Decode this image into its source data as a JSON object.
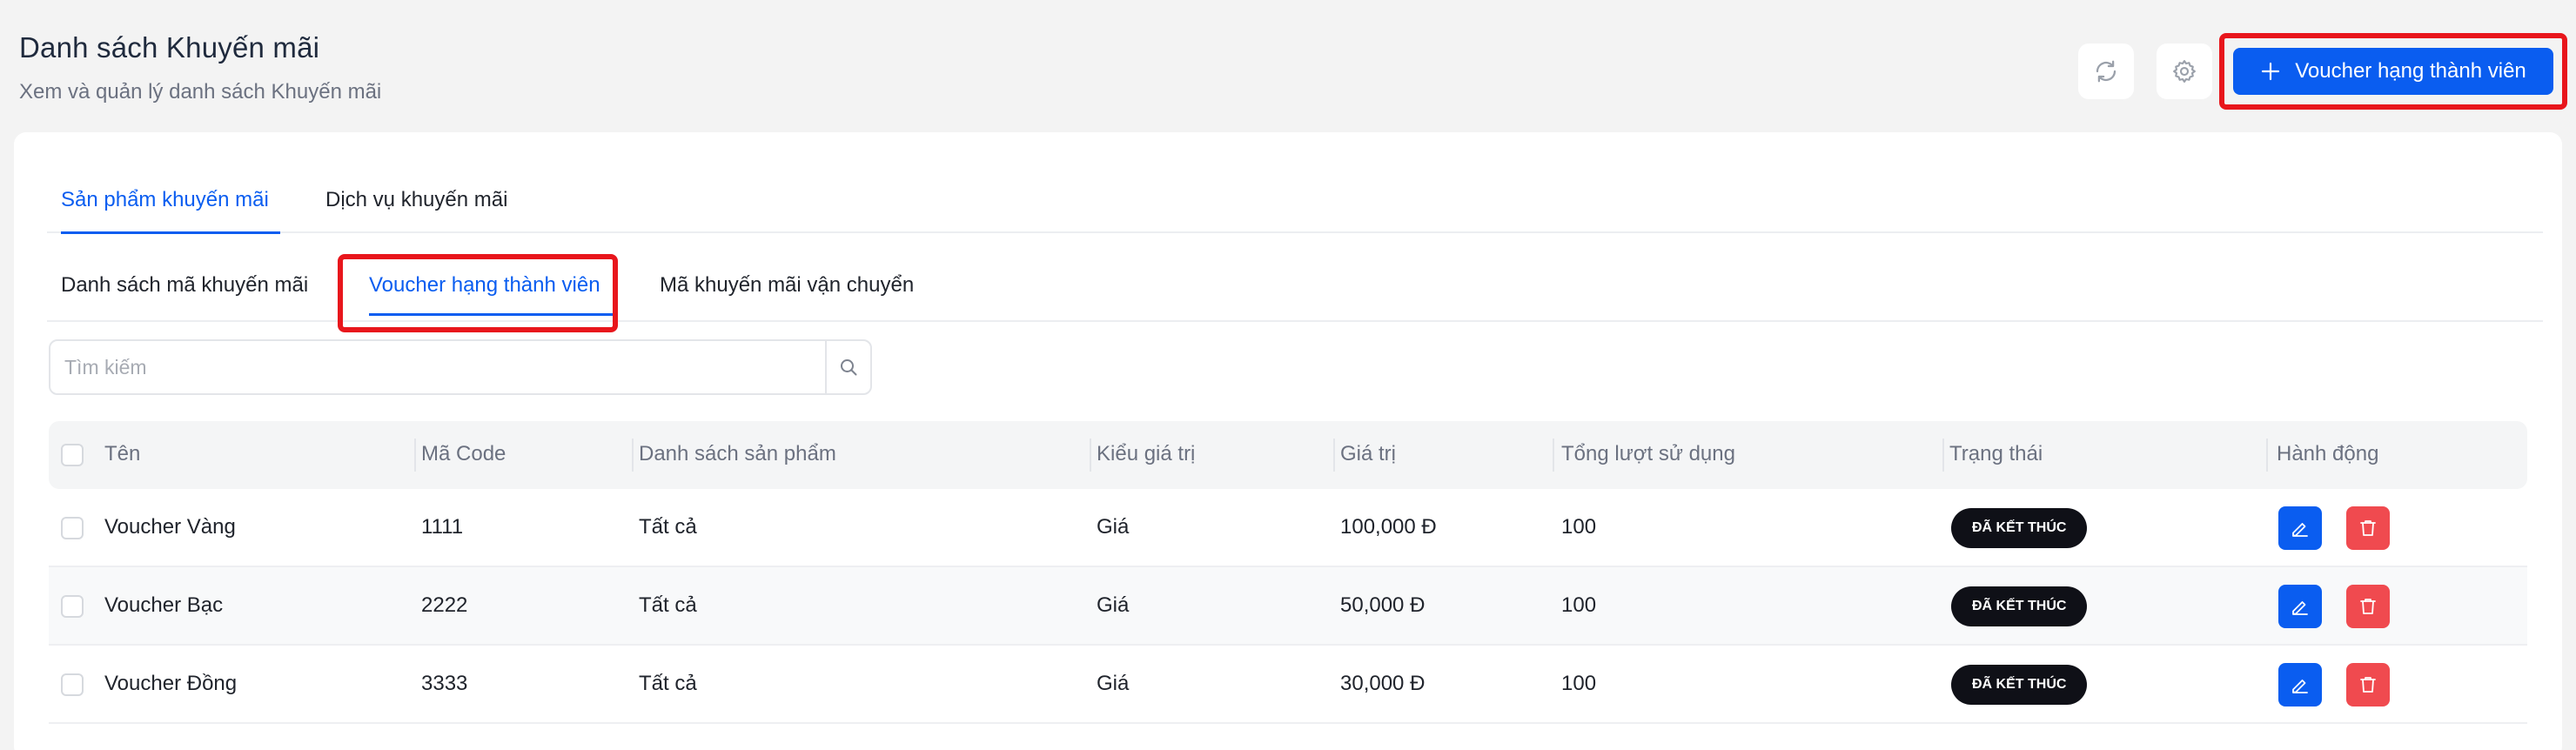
{
  "header": {
    "title": "Danh sách Khuyến mãi",
    "subtitle": "Xem và quản lý danh sách Khuyến mãi",
    "refresh_icon": "refresh-icon",
    "settings_icon": "gear-icon",
    "primary_button_label": "Voucher hạng thành viên",
    "primary_button_icon": "plus-icon"
  },
  "tabs": [
    {
      "label": "Sản phẩm khuyến mãi",
      "active": true
    },
    {
      "label": "Dịch vụ khuyến mãi",
      "active": false
    }
  ],
  "subtabs": [
    {
      "label": "Danh sách mã khuyến mãi",
      "active": false
    },
    {
      "label": "Voucher hạng thành viên",
      "active": true
    },
    {
      "label": "Mã khuyến mãi vận chuyển",
      "active": false
    }
  ],
  "search": {
    "placeholder": "Tìm kiếm",
    "value": ""
  },
  "table": {
    "columns": [
      "Tên",
      "Mã Code",
      "Danh sách sản phẩm",
      "Kiểu giá trị",
      "Giá trị",
      "Tổng lượt sử dụng",
      "Trạng thái",
      "Hành động"
    ],
    "rows": [
      {
        "name": "Voucher Vàng",
        "code": "1111",
        "products": "Tất cả",
        "value_type": "Giá",
        "value": "100,000 Đ",
        "usage": "100",
        "status": "ĐÃ KẾT THÚC"
      },
      {
        "name": "Voucher Bạc",
        "code": "2222",
        "products": "Tất cả",
        "value_type": "Giá",
        "value": "50,000 Đ",
        "usage": "100",
        "status": "ĐÃ KẾT THÚC"
      },
      {
        "name": "Voucher Đồng",
        "code": "3333",
        "products": "Tất cả",
        "value_type": "Giá",
        "value": "30,000 Đ",
        "usage": "100",
        "status": "ĐÃ KẾT THÚC"
      }
    ]
  },
  "colors": {
    "accent": "#0a5df0",
    "danger": "#f04a4f",
    "highlight": "#e8161c",
    "badge": "#0f1017"
  }
}
